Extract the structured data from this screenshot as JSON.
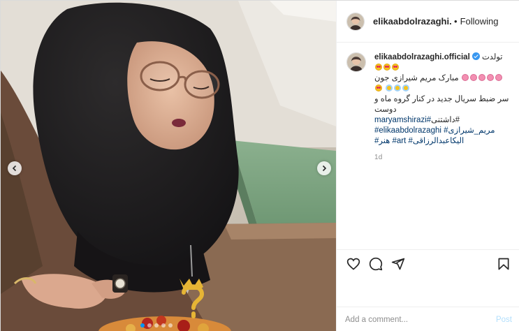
{
  "header": {
    "username": "elikaabdolrazaghi.offic",
    "separator": "•",
    "follow_status": "Following"
  },
  "caption": {
    "username": "elikaabdolrazaghi.official",
    "verified": true,
    "line1": "تولدت",
    "line2": "مبارک مریم شیرازی جون",
    "line3": "سر ضبط سریال جدید در کنار گروه ماه و دوست",
    "line4": "داشتنی#",
    "tag_maryam": "maryamshirazi#",
    "tag_maryam_fa": "مریم_شیرازی#",
    "tag_elika": "elikaabdolrazaghi#",
    "tag_honar": "هنر#",
    "tag_art": "art#",
    "tag_elika_fa": "الیکاعبدالرزاقی#",
    "time": "1d"
  },
  "carousel": {
    "slides": 5,
    "active_index": 0
  },
  "actions": {
    "like_icon": "heart-icon",
    "comment_icon": "comment-icon",
    "share_icon": "share-icon",
    "save_icon": "bookmark-icon"
  },
  "comment": {
    "placeholder": "Add a comment...",
    "post_label": "Post"
  },
  "colors": {
    "link": "#00376b",
    "verified": "#3897f0",
    "post_disabled": "#b2dffc",
    "secondary_text": "#8e8e8e"
  }
}
